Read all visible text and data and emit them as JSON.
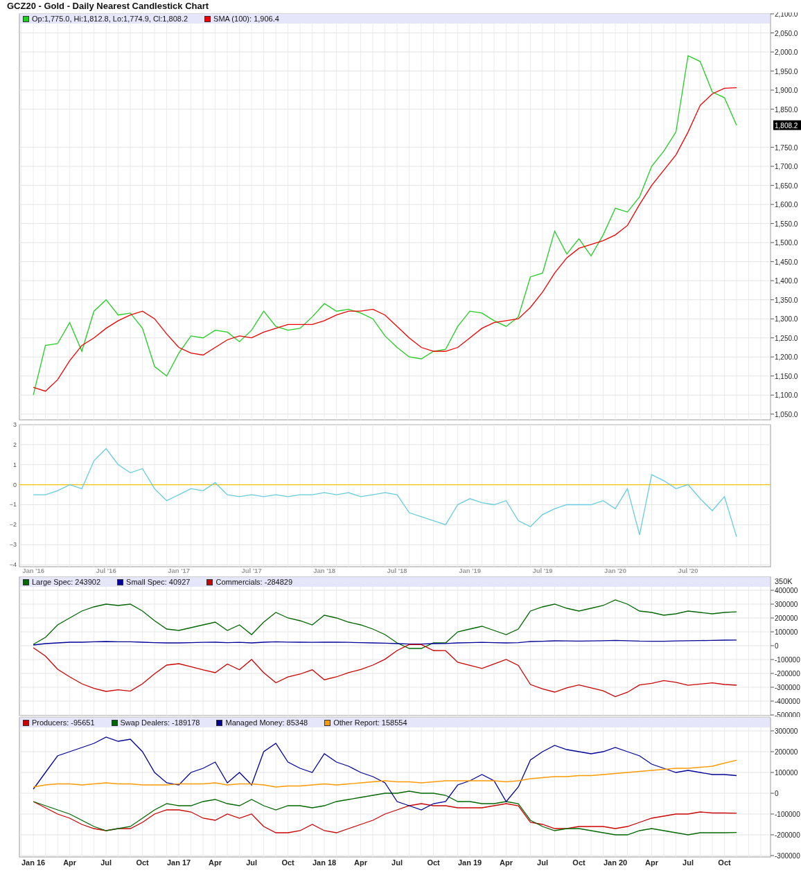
{
  "title": "GCZ20 - Gold - Daily Nearest Candlestick Chart",
  "panels": [
    {
      "chart_data": {
        "type": "line",
        "grid": true,
        "legend": "upper left",
        "ylim": [
          1035,
          2100
        ],
        "yticks": [
          {
            "value": 1050,
            "label": "1,050.0"
          },
          {
            "value": 1100,
            "label": "1,100.0"
          },
          {
            "value": 1150,
            "label": "1,150.0"
          },
          {
            "value": 1200,
            "label": "1,200.0"
          },
          {
            "value": 1250,
            "label": "1,250.0"
          },
          {
            "value": 1300,
            "label": "1,300.0"
          },
          {
            "value": 1350,
            "label": "1,350.0"
          },
          {
            "value": 1400,
            "label": "1,400.0"
          },
          {
            "value": 1450,
            "label": "1,450.0"
          },
          {
            "value": 1500,
            "label": "1,500.0"
          },
          {
            "value": 1550,
            "label": "1,550.0"
          },
          {
            "value": 1600,
            "label": "1,600.0"
          },
          {
            "value": 1650,
            "label": "1,650.0"
          },
          {
            "value": 1700,
            "label": "1,700.0"
          },
          {
            "value": 1750,
            "label": "1,750.0"
          },
          {
            "value": 1850,
            "label": "1,850.0"
          },
          {
            "value": 1900,
            "label": "1,900.0"
          },
          {
            "value": 1950,
            "label": "1,950.0"
          },
          {
            "value": 2000,
            "label": "2,000.0"
          },
          {
            "value": 2050,
            "label": "2,050.0"
          },
          {
            "value": 2100,
            "label": "2,100.0"
          }
        ],
        "series": [
          {
            "name": "Op:1,775.0, Hi:1,812.8, Lo:1,774.9, Cl:1,808.2",
            "color": "#22cc22",
            "values": [
              1100,
              1230,
              1235,
              1290,
              1215,
              1320,
              1350,
              1310,
              1315,
              1275,
              1175,
              1150,
              1210,
              1255,
              1250,
              1270,
              1265,
              1240,
              1270,
              1320,
              1280,
              1270,
              1275,
              1305,
              1340,
              1320,
              1325,
              1315,
              1300,
              1255,
              1225,
              1200,
              1195,
              1215,
              1220,
              1280,
              1320,
              1315,
              1295,
              1280,
              1305,
              1410,
              1420,
              1530,
              1470,
              1510,
              1465,
              1520,
              1590,
              1580,
              1620,
              1700,
              1740,
              1790,
              1990,
              1975,
              1895,
              1880,
              1808
            ]
          },
          {
            "name": "SMA (100): 1,906.4",
            "color": "#ee0000",
            "values": [
              1120,
              1110,
              1140,
              1190,
              1230,
              1250,
              1275,
              1295,
              1310,
              1320,
              1300,
              1260,
              1225,
              1210,
              1205,
              1225,
              1245,
              1255,
              1250,
              1265,
              1275,
              1285,
              1285,
              1285,
              1295,
              1310,
              1320,
              1320,
              1325,
              1310,
              1280,
              1250,
              1225,
              1215,
              1215,
              1225,
              1250,
              1275,
              1290,
              1295,
              1300,
              1330,
              1370,
              1420,
              1460,
              1485,
              1495,
              1505,
              1520,
              1545,
              1600,
              1650,
              1690,
              1730,
              1790,
              1860,
              1890,
              1905,
              1906
            ]
          }
        ],
        "annotations": [
          "1,808.2"
        ]
      }
    },
    {
      "chart_data": {
        "type": "line",
        "grid": true,
        "ylim": [
          -4.1,
          3
        ],
        "categories": [
          "Jan '16",
          null,
          null,
          null,
          null,
          null,
          "Jul '16",
          null,
          null,
          null,
          null,
          null,
          "Jan '17",
          null,
          null,
          null,
          null,
          null,
          "Jul '17",
          null,
          null,
          null,
          null,
          null,
          "Jan '18",
          null,
          null,
          null,
          null,
          null,
          "Jul '18",
          null,
          null,
          null,
          null,
          null,
          "Jan '19",
          null,
          null,
          null,
          null,
          null,
          "Jul '19",
          null,
          null,
          null,
          null,
          null,
          "Jan '20",
          null,
          null,
          null,
          null,
          null,
          "Jul '20",
          null,
          null,
          null,
          null
        ],
        "yticks": [
          {
            "value": 3,
            "label": "3"
          },
          {
            "value": 2,
            "label": "2"
          },
          {
            "value": 1,
            "label": "1"
          },
          {
            "value": 0,
            "label": "0"
          },
          {
            "value": -1,
            "label": "−1"
          },
          {
            "value": -2,
            "label": "−2"
          },
          {
            "value": -3,
            "label": "−3"
          },
          {
            "value": -4,
            "label": "−4"
          }
        ],
        "series": [
          {
            "color": "#66ccdd",
            "values": [
              -0.5,
              -0.5,
              -0.3,
              0.0,
              -0.2,
              1.2,
              1.8,
              1.0,
              0.6,
              0.8,
              -0.2,
              -0.8,
              -0.5,
              -0.2,
              -0.3,
              0.1,
              -0.5,
              -0.6,
              -0.5,
              -0.6,
              -0.5,
              -0.6,
              -0.5,
              -0.5,
              -0.4,
              -0.5,
              -0.4,
              -0.6,
              -0.5,
              -0.4,
              -0.5,
              -1.4,
              -1.6,
              -1.8,
              -2.0,
              -1.0,
              -0.7,
              -0.9,
              -1.0,
              -0.8,
              -1.8,
              -2.1,
              -1.5,
              -1.2,
              -1.0,
              -1.0,
              -1.0,
              -0.8,
              -1.2,
              -0.2,
              -2.5,
              0.5,
              0.2,
              -0.2,
              0.0,
              -0.7,
              -1.3,
              -0.6,
              -2.6
            ]
          }
        ],
        "ref_lines": [
          {
            "axis": "y",
            "value": 0
          }
        ]
      }
    },
    {
      "top_label": "350K",
      "chart_data": {
        "type": "line",
        "grid": true,
        "legend": "upper left",
        "ylim": [
          -505000,
          495000
        ],
        "yticks": [
          400000,
          300000,
          200000,
          100000,
          0,
          -100000,
          -200000,
          -300000,
          -400000,
          -500000
        ],
        "series": [
          {
            "name": "Large Spec: 243902",
            "color": "#006600",
            "values": [
              10000,
              60000,
              150000,
              200000,
              250000,
              280000,
              300000,
              290000,
              300000,
              250000,
              180000,
              120000,
              110000,
              130000,
              150000,
              170000,
              110000,
              150000,
              80000,
              170000,
              240000,
              200000,
              180000,
              150000,
              220000,
              200000,
              170000,
              150000,
              120000,
              80000,
              20000,
              -20000,
              -20000,
              20000,
              20000,
              100000,
              120000,
              140000,
              110000,
              80000,
              120000,
              250000,
              280000,
              300000,
              270000,
              250000,
              270000,
              290000,
              330000,
              300000,
              250000,
              240000,
              220000,
              230000,
              250000,
              240000,
              230000,
              240000,
              244000
            ]
          },
          {
            "name": "Small Spec: 40927",
            "color": "#000099",
            "values": [
              5000,
              15000,
              20000,
              25000,
              25000,
              28000,
              30000,
              28000,
              28000,
              25000,
              22000,
              20000,
              20000,
              22000,
              24000,
              25000,
              22000,
              24000,
              20000,
              25000,
              28000,
              26000,
              25000,
              24000,
              26000,
              25000,
              24000,
              22000,
              20000,
              18000,
              15000,
              12000,
              12000,
              15000,
              16000,
              20000,
              22000,
              24000,
              22000,
              20000,
              22000,
              30000,
              32000,
              35000,
              34000,
              33000,
              34000,
              36000,
              38000,
              36000,
              33000,
              32000,
              32000,
              34000,
              36000,
              37000,
              38000,
              40000,
              41000
            ]
          },
          {
            "name": "Commercials: -284829",
            "color": "#cc0000",
            "values": [
              -15000,
              -75000,
              -170000,
              -225000,
              -275000,
              -308000,
              -330000,
              -318000,
              -328000,
              -275000,
              -202000,
              -140000,
              -130000,
              -152000,
              -174000,
              -195000,
              -132000,
              -174000,
              -100000,
              -195000,
              -268000,
              -226000,
              -205000,
              -174000,
              -246000,
              -225000,
              -194000,
              -172000,
              -140000,
              -98000,
              -35000,
              8000,
              8000,
              -35000,
              -36000,
              -120000,
              -142000,
              -164000,
              -132000,
              -100000,
              -142000,
              -280000,
              -312000,
              -335000,
              -304000,
              -283000,
              -304000,
              -326000,
              -368000,
              -336000,
              -283000,
              -272000,
              -252000,
              -264000,
              -286000,
              -277000,
              -268000,
              -280000,
              -285000
            ]
          }
        ]
      }
    },
    {
      "chart_data": {
        "type": "line",
        "grid": true,
        "legend": "upper left",
        "ylim": [
          -306667,
          363333
        ],
        "categories": [
          "Jan 16",
          null,
          null,
          "Apr",
          null,
          null,
          "Jul",
          null,
          null,
          "Oct",
          null,
          null,
          "Jan 17",
          null,
          null,
          "Apr",
          null,
          null,
          "Jul",
          null,
          null,
          "Oct",
          null,
          null,
          "Jan 18",
          null,
          null,
          "Apr",
          null,
          null,
          "Jul",
          null,
          null,
          "Oct",
          null,
          null,
          "Jan 19",
          null,
          null,
          "Apr",
          null,
          null,
          "Jul",
          null,
          null,
          "Oct",
          null,
          null,
          "Jan 20",
          null,
          null,
          "Apr",
          null,
          null,
          "Jul",
          null,
          null,
          "Oct",
          null
        ],
        "yticks": [
          300000,
          200000,
          100000,
          0,
          -100000,
          -200000,
          -300000
        ],
        "series": [
          {
            "name": "Producers: -95651",
            "color": "#cc0000",
            "values": [
              -40000,
              -70000,
              -100000,
              -120000,
              -150000,
              -170000,
              -180000,
              -170000,
              -170000,
              -140000,
              -100000,
              -80000,
              -80000,
              -90000,
              -120000,
              -130000,
              -100000,
              -120000,
              -100000,
              -160000,
              -190000,
              -190000,
              -180000,
              -150000,
              -180000,
              -190000,
              -170000,
              -150000,
              -130000,
              -100000,
              -80000,
              -60000,
              -50000,
              -60000,
              -60000,
              -70000,
              -70000,
              -70000,
              -60000,
              -50000,
              -60000,
              -140000,
              -150000,
              -170000,
              -170000,
              -160000,
              -160000,
              -160000,
              -170000,
              -160000,
              -140000,
              -120000,
              -110000,
              -100000,
              -100000,
              -90000,
              -95000,
              -95000,
              -96000
            ]
          },
          {
            "name": "Swap Dealers: -189178",
            "color": "#006600",
            "values": [
              -40000,
              -60000,
              -80000,
              -100000,
              -130000,
              -160000,
              -180000,
              -170000,
              -160000,
              -120000,
              -80000,
              -50000,
              -60000,
              -60000,
              -40000,
              -30000,
              -50000,
              -60000,
              -30000,
              -60000,
              -80000,
              -60000,
              -60000,
              -70000,
              -60000,
              -40000,
              -30000,
              -20000,
              -10000,
              0,
              0,
              10000,
              0,
              0,
              -10000,
              -40000,
              -40000,
              -50000,
              -50000,
              -40000,
              -50000,
              -130000,
              -160000,
              -180000,
              -170000,
              -170000,
              -180000,
              -190000,
              -200000,
              -200000,
              -180000,
              -170000,
              -180000,
              -190000,
              -200000,
              -190000,
              -190000,
              -190000,
              -189000
            ]
          },
          {
            "name": "Managed Money: 85348",
            "color": "#000099",
            "values": [
              20000,
              100000,
              180000,
              200000,
              220000,
              240000,
              270000,
              250000,
              260000,
              200000,
              100000,
              50000,
              40000,
              100000,
              120000,
              150000,
              50000,
              100000,
              40000,
              200000,
              240000,
              150000,
              120000,
              100000,
              190000,
              150000,
              130000,
              100000,
              80000,
              50000,
              -40000,
              -60000,
              -80000,
              -50000,
              -40000,
              40000,
              60000,
              90000,
              60000,
              -40000,
              30000,
              160000,
              200000,
              230000,
              210000,
              200000,
              190000,
              200000,
              220000,
              200000,
              180000,
              140000,
              120000,
              100000,
              110000,
              100000,
              90000,
              90000,
              85000
            ]
          },
          {
            "name": "Other Report: 158554",
            "color": "#ff9900",
            "values": [
              30000,
              40000,
              45000,
              45000,
              40000,
              45000,
              50000,
              45000,
              45000,
              40000,
              40000,
              40000,
              45000,
              45000,
              45000,
              50000,
              40000,
              45000,
              45000,
              40000,
              30000,
              35000,
              35000,
              40000,
              45000,
              40000,
              45000,
              50000,
              55000,
              60000,
              55000,
              55000,
              50000,
              55000,
              60000,
              60000,
              60000,
              60000,
              60000,
              55000,
              60000,
              70000,
              75000,
              80000,
              80000,
              85000,
              85000,
              90000,
              95000,
              100000,
              105000,
              110000,
              115000,
              120000,
              120000,
              125000,
              130000,
              145000,
              159000
            ]
          }
        ]
      }
    }
  ]
}
